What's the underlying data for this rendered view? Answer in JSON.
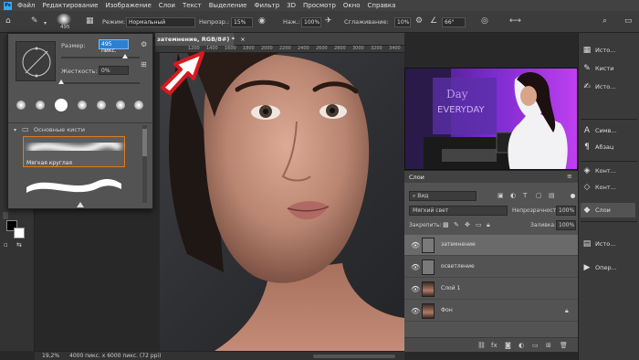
{
  "menu": {
    "app_icon": "Ps",
    "items": [
      "Файл",
      "Редактирование",
      "Изображение",
      "Слои",
      "Текст",
      "Выделение",
      "Фильтр",
      "3D",
      "Просмотр",
      "Окно",
      "Справка"
    ]
  },
  "options": {
    "brush_size": "495",
    "mode_label": "Режим:",
    "mode_value": "Нормальный",
    "opacity_label": "Непрозр.:",
    "opacity_value": "15%",
    "pressure_label": "Наж.:",
    "pressure_value": "100%",
    "smoothing_label": "Сглаживание:",
    "smoothing_value": "10%",
    "angle_value": "66°"
  },
  "document_tab": {
    "title": "затемнение, RGB/8#) *",
    "close": "×"
  },
  "ruler_marks": [
    "1200",
    "1400",
    "1600",
    "1800",
    "2000",
    "2200",
    "2400",
    "2600",
    "2800",
    "3000",
    "3200",
    "3400",
    "3600",
    "3800",
    "4000"
  ],
  "status": {
    "zoom": "19,2%",
    "doc_info": "4000 пикс. x 6000 пикс. (72 ppi)"
  },
  "brush_panel": {
    "size_label": "Размер:",
    "size_value": "495 пикс.",
    "hardness_label": "Жесткость:",
    "hardness_value": "0%",
    "folder_label": "Основные кисти",
    "brush_name": "Мягкая круглая"
  },
  "right_panel": {
    "items": [
      "Исто...",
      "Кисти",
      "Исто...",
      "Симв...",
      "Абзац",
      "Конт...",
      "Слои",
      "Исто...",
      "Опер..."
    ]
  },
  "layers_panel": {
    "title": "Слои",
    "filter_label": "Вид",
    "blend_mode": "Мягкий свет",
    "opacity_label": "Непрозрачность:",
    "opacity_value": "100%",
    "lock_label": "Закрепить:",
    "fill_label": "Заливка:",
    "fill_value": "100%",
    "layers": [
      {
        "name": "затемнение"
      },
      {
        "name": "осветление"
      },
      {
        "name": "Слой 1"
      },
      {
        "name": "Фон"
      }
    ]
  },
  "colors": {
    "accent": "#31a8ff",
    "panel_bg": "#535353",
    "arrow": "#d8191f",
    "video_purple": "#8a2be2"
  }
}
